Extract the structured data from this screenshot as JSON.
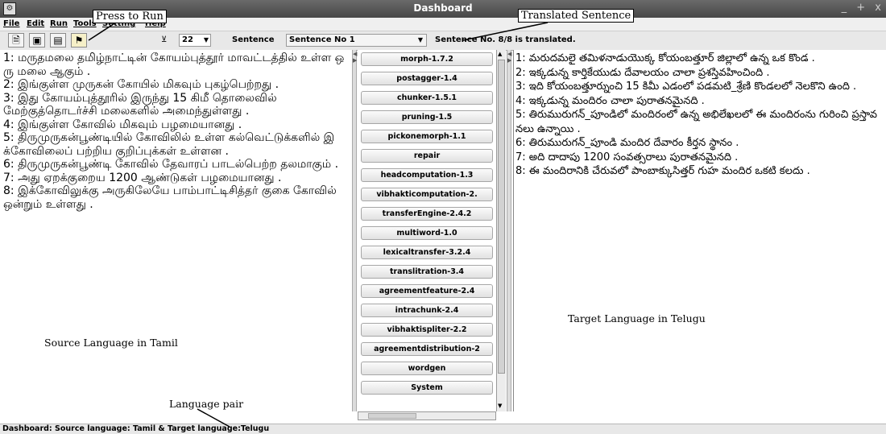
{
  "window": {
    "title": "Dashboard",
    "controls": [
      "_",
      "+",
      "x"
    ]
  },
  "menu": [
    "File",
    "Edit",
    "Run",
    "Tools",
    "Setting",
    "Help"
  ],
  "toolbar": {
    "font_size": "22",
    "mode_label": "Sentence",
    "sentence_select": "Sentence No 1",
    "status_text": "Sentence No. 8/8 is translated."
  },
  "source_text": "1: மருதமலை தமிழ்நாட்டின் கோயம்புத்தூர் மாவட்டத்தில் உள்ள ஒரு மலை ஆகும் .\n2: இங்குள்ள முருகன் கோயில் மிகவும் புகழ்பெற்றது .\n3: இது கோயம்புத்தூரில் இருந்து 15 கிமீ தொலைவில் மேற்குத்தொடர்ச்சி மலைகளில் அமைந்துள்ளது .\n4: இங்குள்ள கோவில் மிகவும் பழமையானது .\n5: திருமுருகன்பூண்டியில் கோவிலில் உள்ள கல்வெட்டுக்களில் இக்கோவிலைப் பற்றிய குறிப்புக்கள் உள்ளன .\n6: திருமுருகன்பூண்டி கோவில் தேவாரப் பாடல்பெற்ற தலமாகும் .\n7: அது ஏறக்குறைய 1200 ஆண்டுகள் பழமையானது .\n8: இக்கோவிலுக்கு அருகிலேயே பாம்பாட்டிசித்தர் குகை கோவில் ஒன்றும் உள்ளது .",
  "target_text": "1: మరుదమలై తమిళనాడుయొక్క కోయంబత్తూర్ జిల్లాలో ఉన్న ఒక కొండ .\n2: ఇక్కడున్న కార్తికేయుడు దేవాలయం చాలా ప్రశస్తివహించింది .\n3: ఇది కోయంబత్తూర్నుంచి 15 కిమీ ఎడంలో పడమటి_శ్రేణి కొండలలో నెలకొని ఉంది .\n4: ఇక్కడున్న మందిరం చాలా పురాతనమైనది .\n5: తిరుమురుగన్_పూండిలో మందిరంలో ఉన్న అభిలేఖలలో ఈ మందిరంను గురించి ప్రస్తావనలు ఉన్నాయి .\n6: తిరుమురుగన్_పూండి మందిర దేవారం కీర్తన స్థానం .\n7: అది దాదాపు 1200 సంవత్సరాలు పురాతనమైనది .\n8: ఈ మందిరానికి చేరువలో పాంబాక్కుసిత్తర్ గుహ మందిర ఒకటి కలదు .",
  "modules": [
    "morph-1.7.2",
    "postagger-1.4",
    "chunker-1.5.1",
    "pruning-1.5",
    "pickonemorph-1.1",
    "repair",
    "headcomputation-1.3",
    "vibhakticomputation-2.",
    "transferEngine-2.4.2",
    "multiword-1.0",
    "lexicaltransfer-3.2.4",
    "translitration-3.4",
    "agreementfeature-2.4",
    "intrachunk-2.4",
    "vibhaktispliter-2.2",
    "agreementdistribution-2",
    "wordgen",
    "System"
  ],
  "statusbar": "Dashboard: Source language: Tamil  & Target language:Telugu",
  "annotations": {
    "press_to_run": "Press to Run",
    "translated_sentence": "Translated Sentence",
    "source_language": "Source Language in Tamil",
    "target_language": "Target Language in Telugu",
    "language_pair": "Language pair"
  }
}
